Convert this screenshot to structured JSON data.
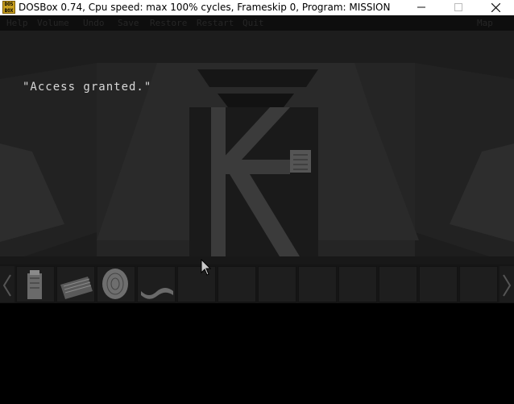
{
  "window": {
    "title": "DOSBox 0.74, Cpu speed: max 100% cycles, Frameskip  0, Program:  MISSION",
    "app_icon_text": "DOS BOX",
    "icons": {
      "minimize": "minimize-icon",
      "maximize": "maximize-icon",
      "close": "close-icon"
    }
  },
  "menubar": {
    "items": [
      "Help",
      "Volume",
      "Undo",
      "Save",
      "Restore",
      "Restart",
      "Quit"
    ],
    "right_item": "Map"
  },
  "scene": {
    "dialogue": "\"Access granted.\""
  },
  "inventory": {
    "item_icons": [
      "canister-icon",
      "device-icon",
      "disc-icon",
      "wrench-icon"
    ],
    "empty_slot_count": 8,
    "icons": {
      "left": "inventory-left-arrow-icon",
      "right": "inventory-right-arrow-icon"
    }
  },
  "cursor": {
    "icon": "mouse-pointer-icon"
  }
}
